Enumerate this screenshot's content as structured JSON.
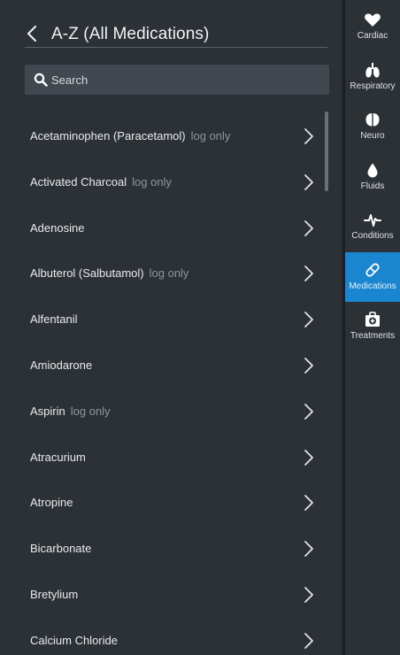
{
  "header": {
    "title": "A-Z (All Medications)"
  },
  "search": {
    "placeholder": "Search"
  },
  "medications": [
    {
      "name": "Acetaminophen (Paracetamol)",
      "tag": "log only"
    },
    {
      "name": "Activated Charcoal",
      "tag": "log only"
    },
    {
      "name": "Adenosine",
      "tag": ""
    },
    {
      "name": "Albuterol (Salbutamol)",
      "tag": "log only"
    },
    {
      "name": "Alfentanil",
      "tag": ""
    },
    {
      "name": "Amiodarone",
      "tag": ""
    },
    {
      "name": "Aspirin",
      "tag": "log only"
    },
    {
      "name": "Atracurium",
      "tag": ""
    },
    {
      "name": "Atropine",
      "tag": ""
    },
    {
      "name": "Bicarbonate",
      "tag": ""
    },
    {
      "name": "Bretylium",
      "tag": ""
    },
    {
      "name": "Calcium Chloride",
      "tag": ""
    }
  ],
  "nav": [
    {
      "label": "Cardiac",
      "icon": "heart-icon"
    },
    {
      "label": "Respiratory",
      "icon": "lungs-icon"
    },
    {
      "label": "Neuro",
      "icon": "brain-icon"
    },
    {
      "label": "Fluids",
      "icon": "drop-icon"
    },
    {
      "label": "Conditions",
      "icon": "pulse-icon"
    },
    {
      "label": "Medications",
      "icon": "pill-icon",
      "active": true
    },
    {
      "label": "Treatments",
      "icon": "medkit-icon"
    }
  ],
  "colors": {
    "background": "#2c3136",
    "accent": "#1a86d0",
    "tag": "#8e959b"
  }
}
